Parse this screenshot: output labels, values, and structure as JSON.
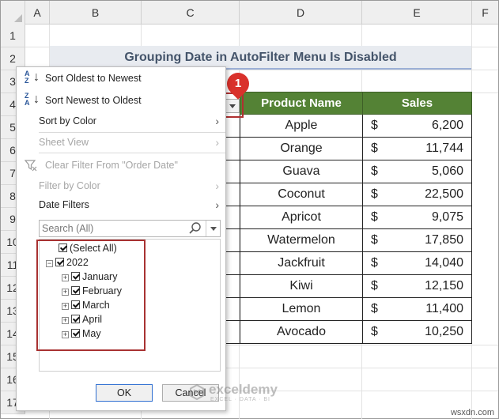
{
  "sheet": {
    "columns": [
      "A",
      "B",
      "C",
      "D",
      "E",
      "F"
    ],
    "rows": [
      "1",
      "2",
      "3",
      "4",
      "5",
      "6",
      "7",
      "8",
      "9",
      "10",
      "11",
      "12",
      "13",
      "14",
      "15",
      "16",
      "17"
    ],
    "title": "Grouping Date in AutoFilter Menu Is Disabled",
    "table": {
      "headers": [
        "Product Name",
        "Sales"
      ],
      "currency_symbol": "$",
      "rows": [
        {
          "name": "Apple",
          "sales": "6,200"
        },
        {
          "name": "Orange",
          "sales": "11,744"
        },
        {
          "name": "Guava",
          "sales": "5,060"
        },
        {
          "name": "Coconut",
          "sales": "22,500"
        },
        {
          "name": "Apricot",
          "sales": "9,075"
        },
        {
          "name": "Watermelon",
          "sales": "17,850"
        },
        {
          "name": "Jackfruit",
          "sales": "14,040"
        },
        {
          "name": "Kiwi",
          "sales": "12,150"
        },
        {
          "name": "Lemon",
          "sales": "11,400"
        },
        {
          "name": "Avocado",
          "sales": "10,250"
        }
      ]
    },
    "header_color": "#548235"
  },
  "callout": {
    "number": "1",
    "color": "#d9312b"
  },
  "filter_menu": {
    "sort_oldest": "Sort Oldest to Newest",
    "sort_newest": "Sort Newest to Oldest",
    "sort_by_color": "Sort by Color",
    "sheet_view": "Sheet View",
    "clear_filter": "Clear Filter From \"Order Date\"",
    "filter_by_color": "Filter by Color",
    "date_filters": "Date Filters",
    "search_placeholder": "Search (All)",
    "tree": {
      "select_all": "(Select All)",
      "year": "2022",
      "months": [
        "January",
        "February",
        "March",
        "April",
        "May"
      ]
    },
    "ok": "OK",
    "cancel": "Cancel"
  },
  "watermark": {
    "name": "exceldemy",
    "tagline": "EXCEL · DATA · BI"
  },
  "site": "wsxdn.com"
}
